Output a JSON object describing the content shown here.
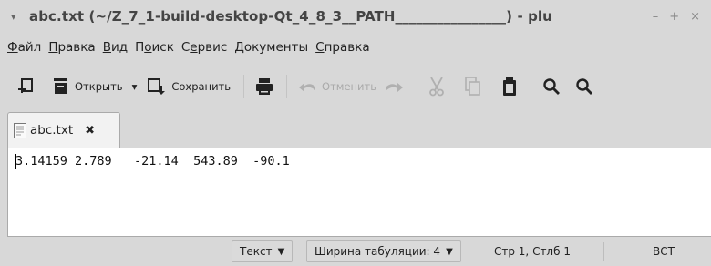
{
  "window": {
    "title": "abc.txt (~/Z_7_1-build-desktop-Qt_4_8_3__PATH________________) - plu",
    "menu_arrow": "▾",
    "minimize": "–",
    "maximize": "+",
    "close": "×"
  },
  "menubar": {
    "items": [
      {
        "key": "Ф",
        "rest": "айл"
      },
      {
        "key": "П",
        "rest": "равка"
      },
      {
        "key": "В",
        "rest": "ид"
      },
      {
        "pre": "П",
        "key": "о",
        "rest": "иск"
      },
      {
        "pre": "С",
        "key": "е",
        "rest": "рвис"
      },
      {
        "key": "Д",
        "rest": "окументы"
      },
      {
        "key": "С",
        "rest": "правка"
      }
    ]
  },
  "toolbar": {
    "new_icon": "new-document-icon",
    "open_label": "Открыть",
    "open_dropdown": "▾",
    "save_label": "Сохранить",
    "print_icon": "printer-icon",
    "undo_label": "Отменить",
    "redo_icon": "redo-icon",
    "cut_icon": "scissors-icon",
    "copy_icon": "copy-icon",
    "paste_icon": "clipboard-icon",
    "find_icon": "search-icon",
    "find_replace_icon": "search-replace-icon"
  },
  "tabs": [
    {
      "label": "abc.txt",
      "close": "✖",
      "active": true
    }
  ],
  "editor": {
    "content": "3.14159 2.789   -21.14  543.89  -90.1"
  },
  "statusbar": {
    "syntax": "Текст",
    "syntax_arrow": "▼",
    "tab_width": "Ширина табуляции: 4",
    "tab_width_arrow": "▼",
    "position": "Стр 1, Стлб 1",
    "mode": "ВСТ"
  },
  "colors": {
    "chrome_bg": "#d8d8d8",
    "editor_bg": "#ffffff",
    "disabled_text": "#aaaaaa"
  }
}
